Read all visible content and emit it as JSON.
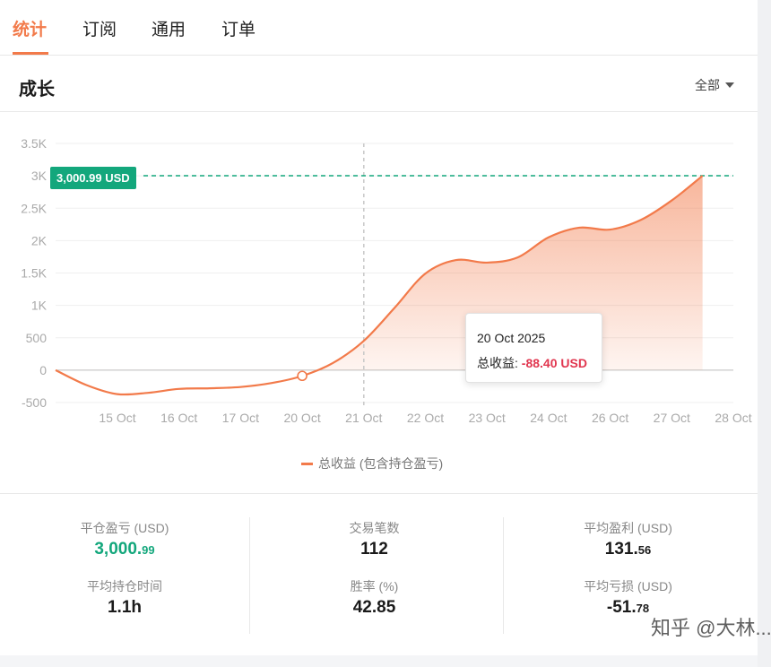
{
  "tabs": [
    {
      "label": "统计",
      "active": true
    },
    {
      "label": "订阅",
      "active": false
    },
    {
      "label": "通用",
      "active": false
    },
    {
      "label": "订单",
      "active": false
    }
  ],
  "section": {
    "title": "成长",
    "range_label": "全部"
  },
  "chart_data": {
    "type": "area",
    "y_ticks": [
      "3.5K",
      "3K",
      "2.5K",
      "2K",
      "1.5K",
      "1K",
      "500",
      "0",
      "-500"
    ],
    "y_tick_values": [
      3500,
      3000,
      2500,
      2000,
      1500,
      1000,
      500,
      0,
      -500
    ],
    "ylim": [
      -500,
      3500
    ],
    "x_ticks": [
      "15 Oct",
      "16 Oct",
      "17 Oct",
      "20 Oct",
      "21 Oct",
      "22 Oct",
      "23 Oct",
      "24 Oct",
      "26 Oct",
      "27 Oct",
      "28 Oct"
    ],
    "series": [
      {
        "name": "总收益 (包含持仓盈亏)",
        "color": "#f27a4a",
        "x": [
          0,
          0.5,
          1.0,
          1.5,
          2.0,
          2.5,
          3.0,
          3.5,
          4.0,
          4.5,
          5.0,
          5.5,
          6.0,
          6.5,
          7.0,
          7.5,
          8.0,
          8.5,
          9.0,
          9.5,
          10.0,
          10.5,
          11.0
        ],
        "values": [
          0,
          -230,
          -370,
          -350,
          -290,
          -280,
          -260,
          -200,
          -90,
          110,
          450,
          960,
          1490,
          1700,
          1660,
          1740,
          2050,
          2200,
          2170,
          2320,
          2620,
          3000.99,
          3000.99
        ]
      }
    ],
    "reference_line": {
      "value": 3000.99,
      "label": "3,000.99 USD",
      "color": "#13a77c"
    },
    "crosshair_x_label": "21 Oct",
    "highlight": {
      "x_label": "20 Oct",
      "value": -88.4
    },
    "grid": true,
    "legend_position": "bottom"
  },
  "tooltip": {
    "date": "20 Oct 2025",
    "label": "总收益:",
    "value": "-88.40 USD"
  },
  "price_tag": "3,000.99 USD",
  "legend_label": "总收益 (包含持仓盈亏)",
  "stats": {
    "closed_pnl": {
      "label": "平仓盈亏 (USD)",
      "main": "3,000.",
      "decimals": "99"
    },
    "trade_count": {
      "label": "交易笔数",
      "value": "112"
    },
    "avg_profit": {
      "label": "平均盈利 (USD)",
      "main": "131.",
      "decimals": "56"
    },
    "avg_hold_time": {
      "label": "平均持仓时间",
      "value": "1.1h"
    },
    "win_rate": {
      "label": "胜率 (%)",
      "value": "42.85"
    },
    "avg_loss": {
      "label": "平均亏损 (USD)",
      "main": "-51.",
      "decimals": "78"
    }
  },
  "watermark": "知乎 @大林..."
}
